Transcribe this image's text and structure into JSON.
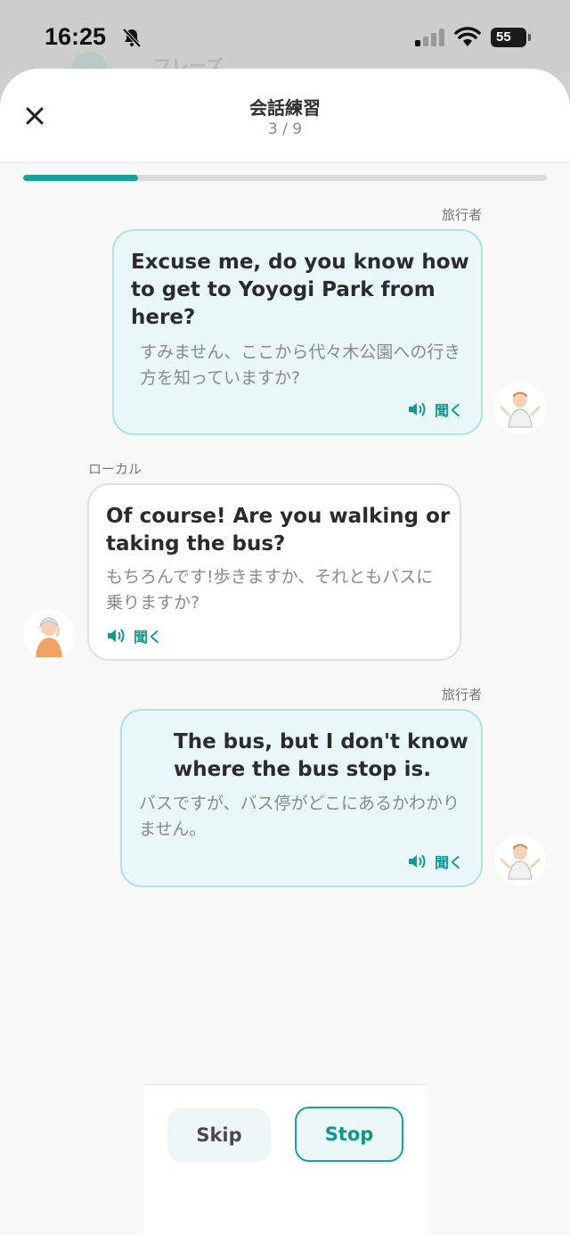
{
  "status_bar": {
    "time": "16:25",
    "battery": "55"
  },
  "background_screen": {
    "label": "フレーズ"
  },
  "header": {
    "title": "会話練習",
    "progress_text": "3 / 9"
  },
  "progress": {
    "fraction": 0.22
  },
  "messages": [
    {
      "speaker": "旅行者",
      "english": "Excuse me, do you know how to get to Yoyogi Park from here?",
      "japanese": "すみません、ここから代々木公園への行き方を知っていますか?",
      "listen_label": "聞く"
    },
    {
      "speaker": "ローカル",
      "english": "Of course! Are you walking or taking the bus?",
      "japanese": "もちろんです!歩きますか、それともバスに乗りますか?",
      "listen_label": "聞く"
    },
    {
      "speaker": "旅行者",
      "english": "The bus, but I don't know where the bus stop is.",
      "japanese": "バスですが、バス停がどこにあるかわかりません。",
      "listen_label": "聞く"
    }
  ],
  "controls": {
    "skip_label": "Skip",
    "stop_label": "Stop"
  },
  "colors": {
    "accent": "#19a19a",
    "traveler_bubble": "#eaf7f8",
    "local_bubble": "#ffffff"
  }
}
